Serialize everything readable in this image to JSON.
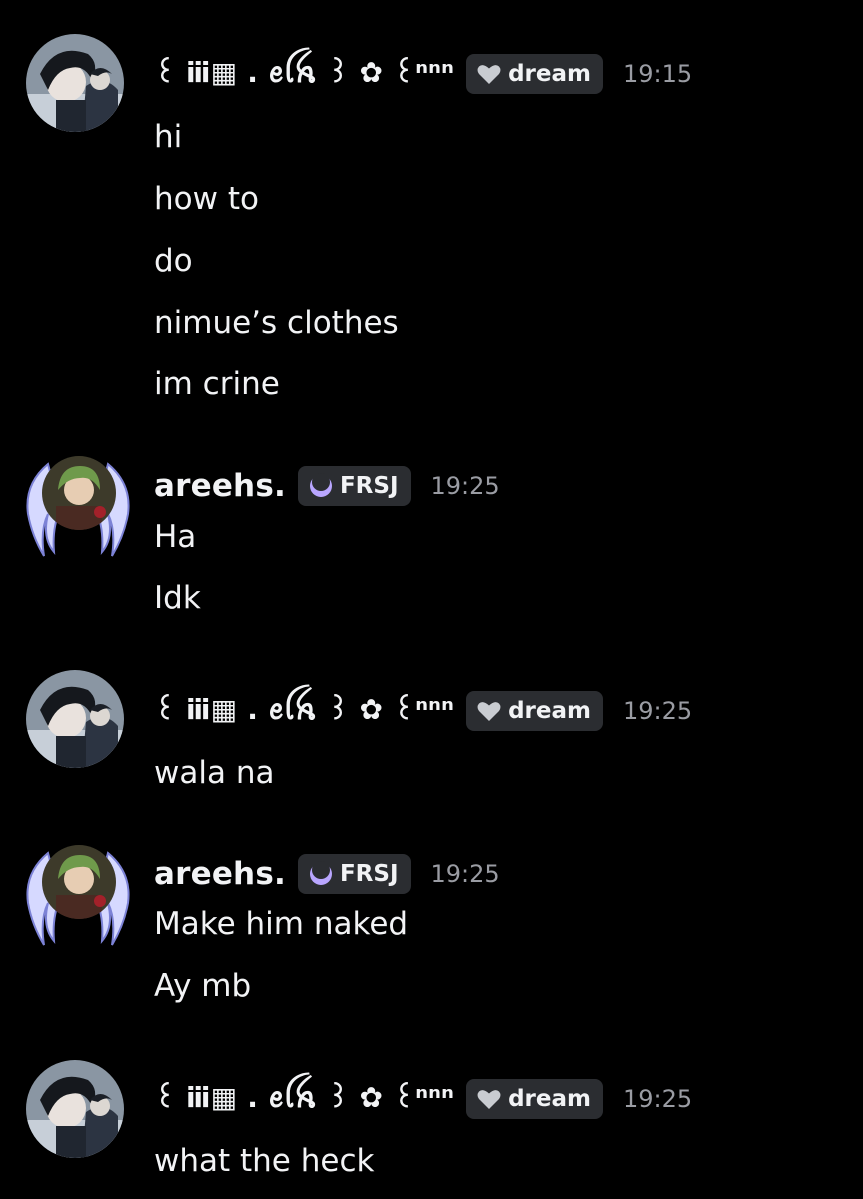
{
  "messages": [
    {
      "author": "꒰ ⅲ▦ . ꫀꪶꫝ ꒱ ✿ ꒰ⁿⁿⁿ",
      "tag": {
        "label": "dream",
        "icon": "heart-icon",
        "color": "#c9ccd1"
      },
      "time": "19:15",
      "lines": [
        "hi",
        "how to",
        "do",
        "nimue’s clothes",
        "im crine"
      ]
    },
    {
      "author": "areehs.",
      "tag": {
        "label": "FRSJ",
        "icon": "crescent-moon-icon",
        "color": "#b9a6ff"
      },
      "time": "19:25",
      "lines": [
        "Ha",
        "Idk"
      ]
    },
    {
      "author": "꒰ ⅲ▦ . ꫀꪶꫝ ꒱ ✿ ꒰ⁿⁿⁿ",
      "tag": {
        "label": "dream",
        "icon": "heart-icon",
        "color": "#c9ccd1"
      },
      "time": "19:25",
      "lines": [
        "wala na"
      ]
    },
    {
      "author": "areehs.",
      "tag": {
        "label": "FRSJ",
        "icon": "crescent-moon-icon",
        "color": "#b9a6ff"
      },
      "time": "19:25",
      "lines": [
        "Make him naked",
        "Ay mb"
      ]
    },
    {
      "author": "꒰ ⅲ▦ . ꫀꪶꫝ ꒱ ✿ ꒰ⁿⁿⁿ",
      "tag": {
        "label": "dream",
        "icon": "heart-icon",
        "color": "#c9ccd1"
      },
      "time": "19:25",
      "lines": [
        "what the heck"
      ]
    }
  ],
  "colors": {
    "background": "#000000",
    "text": "#f2f3f5",
    "timestamp": "#9a9ca3",
    "tag_bg": "#2b2d31"
  }
}
